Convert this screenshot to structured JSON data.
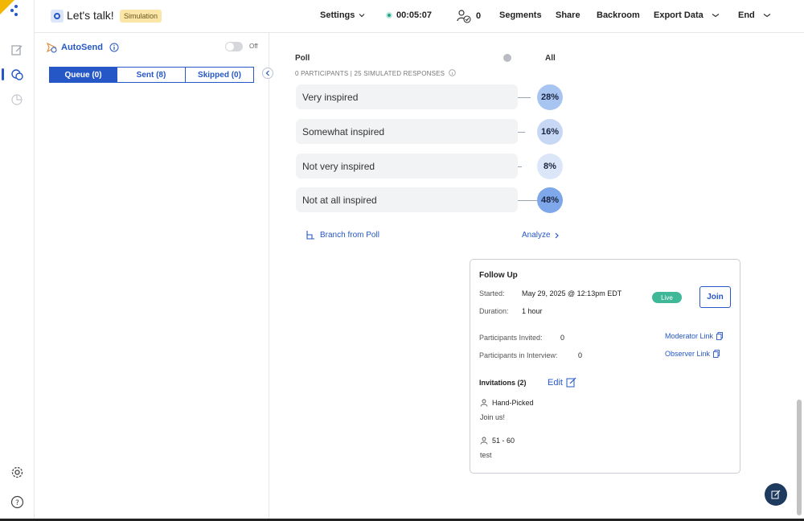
{
  "header": {
    "title": "Let's talk!",
    "badge": "Simulation",
    "nav": {
      "settings": "Settings",
      "timer": "00:05:07",
      "participants_count": "0",
      "segments": "Segments",
      "share": "Share",
      "backroom": "Backroom",
      "export": "Export Data",
      "end": "End"
    }
  },
  "sidebar": {
    "autosend_label": "AutoSend",
    "toggle_state": "Off",
    "tabs": [
      {
        "label": "Queue (0)",
        "active": true
      },
      {
        "label": "Sent (8)",
        "active": false
      },
      {
        "label": "Skipped (0)",
        "active": false
      }
    ]
  },
  "poll": {
    "title": "Poll",
    "filter": "All",
    "subtitle": "0 PARTICIPANTS | 25 SIMULATED RESPONSES",
    "options": [
      {
        "label": "Very inspired",
        "percent": "28%",
        "value": 28,
        "color": "#a8c4f0"
      },
      {
        "label": "Somewhat inspired",
        "percent": "16%",
        "value": 16,
        "color": "#c7d8f5"
      },
      {
        "label": "Not very inspired",
        "percent": "8%",
        "value": 8,
        "color": "#dbe6f8"
      },
      {
        "label": "Not at all inspired",
        "percent": "48%",
        "value": 48,
        "color": "#7ea8ea"
      }
    ],
    "branch_label": "Branch from Poll",
    "analyze_label": "Analyze"
  },
  "followup": {
    "title": "Follow Up",
    "started_label": "Started:",
    "started_value": "May 29, 2025 @ 12:13pm EDT",
    "duration_label": "Duration:",
    "duration_value": "1 hour",
    "status": "Live",
    "join_label": "Join",
    "invited_label": "Participants Invited:",
    "invited_value": "0",
    "in_interview_label": "Participants in Interview:",
    "in_interview_value": "0",
    "moderator_link": "Moderator Link",
    "observer_link": "Observer Link",
    "invitations_label": "Invitations (2)",
    "edit_label": "Edit",
    "invitations": [
      {
        "name": "Hand-Picked",
        "message": "Join us!"
      },
      {
        "name": "51 - 60",
        "message": "test"
      }
    ]
  },
  "colors": {
    "accent": "#2557c7",
    "live": "#3fb898",
    "badge": "#fbe6a8"
  }
}
